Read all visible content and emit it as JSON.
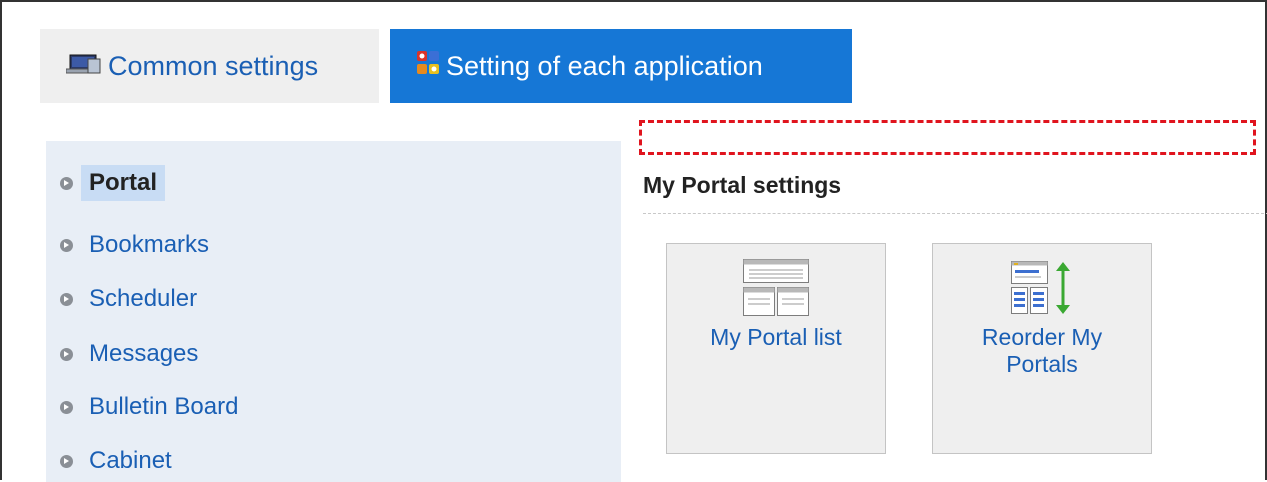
{
  "tabs": [
    {
      "label": "Common settings",
      "icon": "computer-icon",
      "active": false
    },
    {
      "label": "Setting of each application",
      "icon": "apps-icon",
      "active": true
    }
  ],
  "sidebar": {
    "items": [
      {
        "label": "Portal",
        "active": true
      },
      {
        "label": "Bookmarks"
      },
      {
        "label": "Scheduler"
      },
      {
        "label": "Messages"
      },
      {
        "label": "Bulletin Board"
      },
      {
        "label": "Cabinet"
      }
    ]
  },
  "main": {
    "section_title": "My Portal settings",
    "cards": [
      {
        "label": "My Portal list",
        "icon": "portal-list-icon"
      },
      {
        "label": "Reorder My Portals",
        "icon": "reorder-portals-icon"
      }
    ]
  },
  "colors": {
    "accent": "#1677d6",
    "link": "#1a5fb4",
    "highlight": "#e0141e",
    "sidebar_bg": "#e8eef6"
  }
}
